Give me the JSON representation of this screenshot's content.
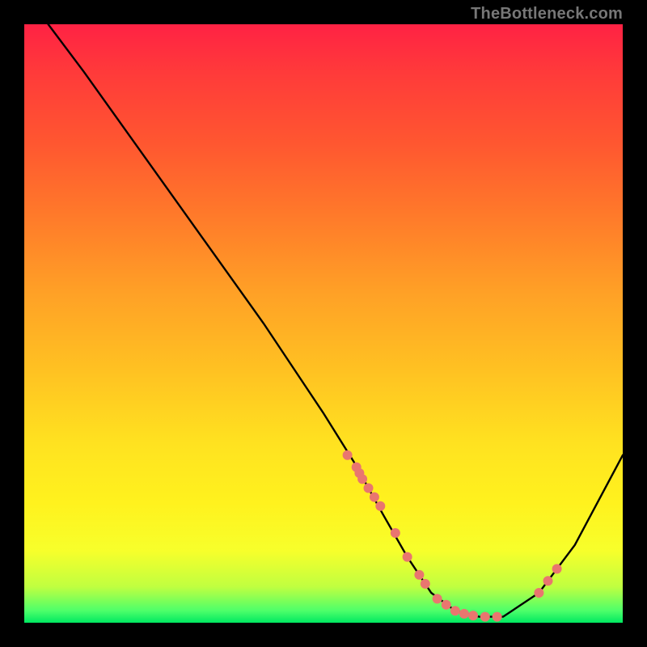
{
  "watermark": "TheBottleneck.com",
  "chart_data": {
    "type": "line",
    "title": "",
    "xlabel": "",
    "ylabel": "",
    "xlim": [
      0,
      100
    ],
    "ylim": [
      0,
      100
    ],
    "grid": false,
    "legend": false,
    "series": [
      {
        "name": "curve",
        "x": [
          4,
          10,
          20,
          30,
          40,
          50,
          55,
          60,
          64,
          68,
          72,
          76,
          80,
          86,
          92,
          100
        ],
        "y": [
          100,
          92,
          78,
          64,
          50,
          35,
          27,
          18,
          11,
          5,
          2,
          1,
          1,
          5,
          13,
          28
        ]
      }
    ],
    "points": {
      "name": "highlighted-points",
      "color": "#e9766f",
      "x": [
        54,
        55.5,
        56,
        56.5,
        57.5,
        58.5,
        59.5,
        62,
        64,
        66,
        67,
        69,
        70.5,
        72,
        73.5,
        75,
        77,
        79,
        86,
        87.5,
        89
      ],
      "y": [
        28,
        26,
        25,
        24,
        22.5,
        21,
        19.5,
        15,
        11,
        8,
        6.5,
        4,
        3,
        2,
        1.5,
        1.2,
        1,
        1,
        5,
        7,
        9
      ]
    }
  }
}
